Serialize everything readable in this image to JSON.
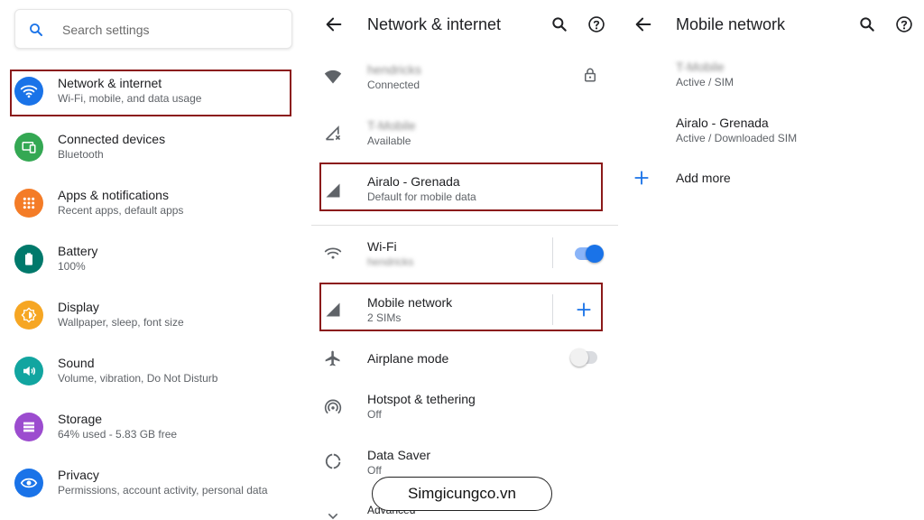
{
  "settings": {
    "search_placeholder": "Search settings",
    "items": [
      {
        "title": "Network & internet",
        "subtitle": "Wi-Fi, mobile, and data usage",
        "icon": "wifi-icon",
        "color": "#1a73e8"
      },
      {
        "title": "Connected devices",
        "subtitle": "Bluetooth",
        "icon": "devices-icon",
        "color": "#34a853"
      },
      {
        "title": "Apps & notifications",
        "subtitle": "Recent apps, default apps",
        "icon": "apps-icon",
        "color": "#f47c27"
      },
      {
        "title": "Battery",
        "subtitle": "100%",
        "icon": "battery-icon",
        "color": "#00796b"
      },
      {
        "title": "Display",
        "subtitle": "Wallpaper, sleep, font size",
        "icon": "display-icon",
        "color": "#f6a623"
      },
      {
        "title": "Sound",
        "subtitle": "Volume, vibration, Do Not Disturb",
        "icon": "sound-icon",
        "color": "#12a5a0"
      },
      {
        "title": "Storage",
        "subtitle": "64% used - 5.83 GB free",
        "icon": "storage-icon",
        "color": "#9c4ccf"
      },
      {
        "title": "Privacy",
        "subtitle": "Permissions, account activity, personal data",
        "icon": "privacy-icon",
        "color": "#1a73e8"
      }
    ]
  },
  "network": {
    "title": "Network & internet",
    "items": [
      {
        "title": "hendricks",
        "subtitle": "Connected",
        "icon": "wifi-connected-icon"
      },
      {
        "title": "T-Mobile",
        "subtitle": "Available",
        "icon": "signal-x-icon"
      },
      {
        "title": "Airalo - Grenada",
        "subtitle": "Default for mobile data",
        "icon": "signal-icon"
      },
      {
        "title": "Wi-Fi",
        "subtitle": "hendricks",
        "icon": "wifi-outline-icon"
      },
      {
        "title": "Mobile network",
        "subtitle": "2 SIMs",
        "icon": "signal-icon"
      },
      {
        "title": "Airplane mode",
        "subtitle": "",
        "icon": "airplane-icon"
      },
      {
        "title": "Hotspot & tethering",
        "subtitle": "Off",
        "icon": "hotspot-icon"
      },
      {
        "title": "Data Saver",
        "subtitle": "Off",
        "icon": "data-saver-icon"
      },
      {
        "title": "Advanced",
        "subtitle": "",
        "icon": "chevron-down-icon"
      }
    ],
    "wifi_toggle_on": true,
    "airplane_toggle_on": false
  },
  "mobile": {
    "title": "Mobile network",
    "items": [
      {
        "title": "T-Mobile",
        "subtitle": "Active / SIM"
      },
      {
        "title": "Airalo - Grenada",
        "subtitle": "Active / Downloaded SIM"
      }
    ],
    "add_more": "Add more"
  },
  "watermark": "Simgicungco.vn",
  "colors": {
    "accent": "#1a73e8",
    "highlight_border": "#8b1a1a",
    "toggle_on": "#1a73e8"
  }
}
